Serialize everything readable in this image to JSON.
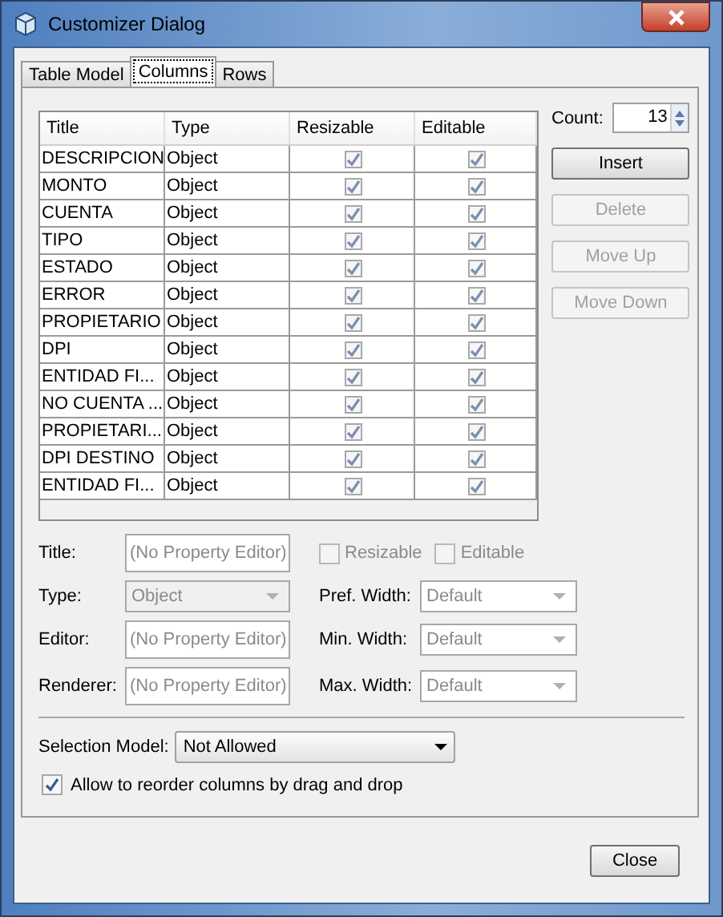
{
  "window": {
    "title": "Customizer Dialog"
  },
  "tabs": [
    {
      "label": "Table Model",
      "selected": false
    },
    {
      "label": "Columns",
      "selected": true
    },
    {
      "label": "Rows",
      "selected": false
    }
  ],
  "table": {
    "columns": [
      "Title",
      "Type",
      "Resizable",
      "Editable"
    ],
    "rows": [
      {
        "title": "DESCRIPCION",
        "type": "Object",
        "resizable": true,
        "editable": true
      },
      {
        "title": "MONTO",
        "type": "Object",
        "resizable": true,
        "editable": true
      },
      {
        "title": "CUENTA",
        "type": "Object",
        "resizable": true,
        "editable": true
      },
      {
        "title": "TIPO",
        "type": "Object",
        "resizable": true,
        "editable": true
      },
      {
        "title": "ESTADO",
        "type": "Object",
        "resizable": true,
        "editable": true
      },
      {
        "title": "ERROR",
        "type": "Object",
        "resizable": true,
        "editable": true
      },
      {
        "title": "PROPIETARIO",
        "type": "Object",
        "resizable": true,
        "editable": true
      },
      {
        "title": "DPI",
        "type": "Object",
        "resizable": true,
        "editable": true
      },
      {
        "title": "ENTIDAD FI...",
        "type": "Object",
        "resizable": true,
        "editable": true
      },
      {
        "title": "NO CUENTA ...",
        "type": "Object",
        "resizable": true,
        "editable": true
      },
      {
        "title": "PROPIETARI...",
        "type": "Object",
        "resizable": true,
        "editable": true
      },
      {
        "title": "DPI DESTINO",
        "type": "Object",
        "resizable": true,
        "editable": true
      },
      {
        "title": "ENTIDAD FI...",
        "type": "Object",
        "resizable": true,
        "editable": true
      }
    ]
  },
  "count": {
    "label": "Count:",
    "value": "13"
  },
  "side_buttons": [
    {
      "label": "Insert",
      "disabled": false
    },
    {
      "label": "Delete",
      "disabled": true
    },
    {
      "label": "Move Up",
      "disabled": true
    },
    {
      "label": "Move Down",
      "disabled": true
    }
  ],
  "properties": [
    {
      "label": "Title:",
      "kind": "text",
      "placeholder": "(No Property Editor)"
    },
    {
      "label": "Type:",
      "kind": "combo",
      "value": "Object"
    },
    {
      "label": "Editor:",
      "kind": "text",
      "placeholder": "(No Property Editor)"
    },
    {
      "label": "Renderer:",
      "kind": "text",
      "placeholder": "(No Property Editor)"
    }
  ],
  "flags": [
    {
      "label": "Resizable",
      "checked": false,
      "disabled": true
    },
    {
      "label": "Editable",
      "checked": false,
      "disabled": true
    }
  ],
  "widths": [
    {
      "label": "Pref. Width:",
      "value": "Default"
    },
    {
      "label": "Min. Width:",
      "value": "Default"
    },
    {
      "label": "Max. Width:",
      "value": "Default"
    }
  ],
  "selection_model": {
    "label": "Selection Model:",
    "value": "Not Allowed"
  },
  "reorder": {
    "label": "Allow to reorder columns by drag and drop",
    "checked": true
  },
  "close_button": {
    "label": "Close"
  }
}
